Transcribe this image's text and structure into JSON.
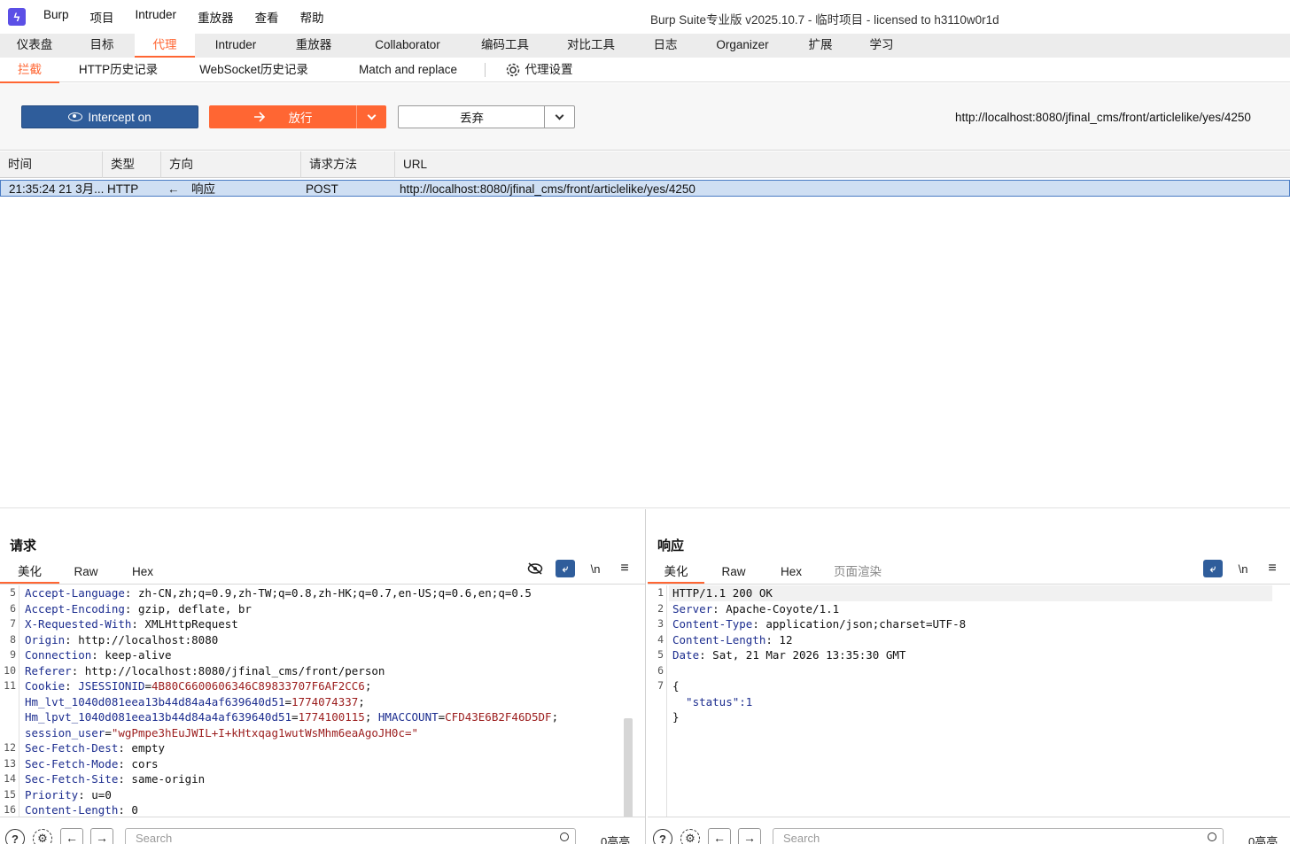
{
  "titlebar": {
    "menu": [
      "Burp",
      "项目",
      "Intruder",
      "重放器",
      "查看",
      "帮助"
    ],
    "window_title": "Burp Suite专业版  v2025.10.7 - 临时项目 - licensed to h3110w0r1d"
  },
  "main_tabs": [
    "仪表盘",
    "目标",
    "代理",
    "Intruder",
    "重放器",
    "Collaborator",
    "编码工具",
    "对比工具",
    "日志",
    "Organizer",
    "扩展",
    "学习"
  ],
  "main_tab_active": "代理",
  "sub_tabs": [
    "拦截",
    "HTTP历史记录",
    "WebSocket历史记录",
    "Match and replace"
  ],
  "proxy_settings_label": "代理设置",
  "toolbar": {
    "intercept_label": "Intercept on",
    "forward_label": "放行",
    "drop_label": "丢弃",
    "url": "http://localhost:8080/jfinal_cms/front/articlelike/yes/4250"
  },
  "table": {
    "headers": [
      "时间",
      "类型",
      "方向",
      "请求方法",
      "URL"
    ],
    "rows": [
      {
        "time": "21:35:24 21 3月...",
        "type": "HTTP",
        "direction_arrow": "←",
        "direction": "响应",
        "method": "POST",
        "url": "http://localhost:8080/jfinal_cms/front/articlelike/yes/4250"
      }
    ]
  },
  "request_pane": {
    "title": "请求",
    "tabs": [
      "美化",
      "Raw",
      "Hex"
    ],
    "lines": [
      {
        "n": "5",
        "key": "Accept-Language",
        "value": " zh-CN,zh;q=0.9,zh-TW;q=0.8,zh-HK;q=0.7,en-US;q=0.6,en;q=0.5"
      },
      {
        "n": "6",
        "key": "Accept-Encoding",
        "value": " gzip, deflate, br"
      },
      {
        "n": "7",
        "key": "X-Requested-With",
        "value": " XMLHttpRequest"
      },
      {
        "n": "8",
        "key": "Origin",
        "value": " http://localhost:8080"
      },
      {
        "n": "9",
        "key": "Connection",
        "value": " keep-alive"
      },
      {
        "n": "10",
        "key": "Referer",
        "value": " http://localhost:8080/jfinal_cms/front/person"
      },
      {
        "n": "11",
        "key": "Cookie",
        "value": " "
      },
      {
        "n": "12",
        "key": "Sec-Fetch-Dest",
        "value": " empty"
      },
      {
        "n": "13",
        "key": "Sec-Fetch-Mode",
        "value": " cors"
      },
      {
        "n": "14",
        "key": "Sec-Fetch-Site",
        "value": " same-origin"
      },
      {
        "n": "15",
        "key": "Priority",
        "value": " u=0"
      },
      {
        "n": "16",
        "key": "Content-Length",
        "value": " 0"
      }
    ],
    "cookies": [
      {
        "name": "JSESSIONID",
        "value": "4B80C6600606346C89833707F6AF2CC6",
        "tail": ";"
      },
      {
        "name": "Hm_lvt_1040d081eea13b44d84a4af639640d51",
        "value": "1774074337",
        "tail": ";"
      },
      {
        "name": "Hm_lpvt_1040d081eea13b44d84a4af639640d51",
        "value": "1774100115",
        "tail": ";"
      },
      {
        "name": "HMACCOUNT",
        "value": "CFD43E6B2F46D5DF",
        "tail": ";"
      },
      {
        "name": "session_user",
        "value": "\"wgPmpe3hEuJWIL+I+kHtxqag1wutWsMhm6eaAgoJH0c=\"",
        "tail": ""
      }
    ],
    "search_placeholder": "Search",
    "match_count": "0高亮"
  },
  "response_pane": {
    "title": "响应",
    "tabs": [
      "美化",
      "Raw",
      "Hex",
      "页面渲染"
    ],
    "lines": [
      {
        "n": "1",
        "key": "",
        "value": "HTTP/1.1 200 OK"
      },
      {
        "n": "2",
        "key": "Server",
        "value": " Apache-Coyote/1.1"
      },
      {
        "n": "3",
        "key": "Content-Type",
        "value": " application/json;charset=UTF-8"
      },
      {
        "n": "4",
        "key": "Content-Length",
        "value": " 12"
      },
      {
        "n": "5",
        "key": "Date",
        "value": " Sat, 21 Mar 2026 13:35:30 GMT"
      },
      {
        "n": "6",
        "key": "",
        "value": ""
      },
      {
        "n": "7",
        "key": "",
        "value": "{"
      },
      {
        "n": "",
        "key": "",
        "value": "  \"status\":1"
      },
      {
        "n": "",
        "key": "",
        "value": "}"
      }
    ],
    "search_placeholder": "Search",
    "match_count": "0高亮"
  },
  "colors": {
    "accent": "#ff6633",
    "primary_blue": "#2f5d9b",
    "selected_row": "#cfdff3"
  },
  "icons": [
    "burp-logo-icon",
    "gear-icon",
    "eye-icon",
    "arrow-right-icon",
    "chevron-down-icon",
    "hide-icon",
    "wrap-icon",
    "newline-icon",
    "menu-icon",
    "help-icon",
    "back-icon",
    "forward-icon",
    "search-icon",
    "layout-split-icon",
    "layout-horizontal-icon",
    "layout-single-icon"
  ]
}
